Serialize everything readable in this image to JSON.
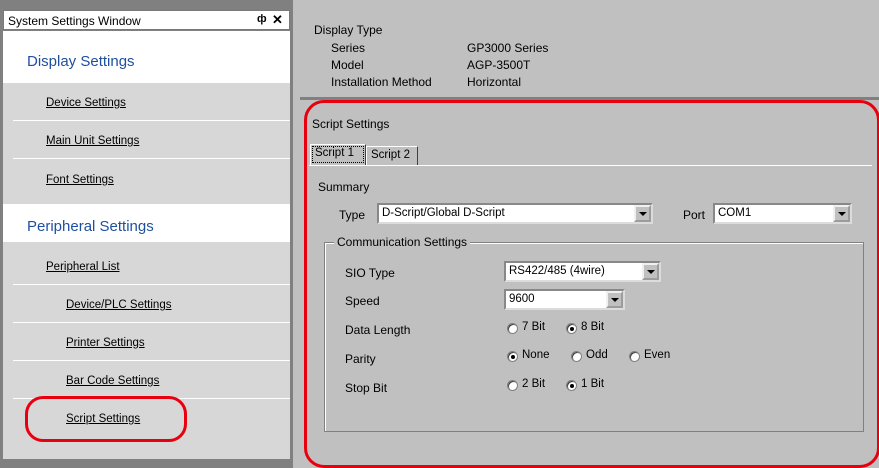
{
  "window": {
    "title": "System Settings Window",
    "pin_glyph": "ф",
    "close_glyph": "✕"
  },
  "sidebar": {
    "display_heading": "Display Settings",
    "display_items": [
      "Device Settings",
      "Main Unit Settings",
      "Font Settings"
    ],
    "peripheral_heading": "Peripheral Settings",
    "peripheral_items": [
      "Peripheral List",
      "Device/PLC Settings",
      "Printer Settings",
      "Bar Code Settings",
      "Script Settings"
    ]
  },
  "display_type": {
    "heading": "Display Type",
    "rows": [
      {
        "label": "Series",
        "value": "GP3000 Series"
      },
      {
        "label": "Model",
        "value": "AGP-3500T"
      },
      {
        "label": "Installation Method",
        "value": "Horizontal"
      }
    ]
  },
  "script_settings": {
    "heading": "Script Settings",
    "tabs": [
      "Script 1",
      "Script 2"
    ],
    "summary_label": "Summary",
    "type_label": "Type",
    "type_value": "D-Script/Global D-Script",
    "port_label": "Port",
    "port_value": "COM1",
    "comm": {
      "title": "Communication Settings",
      "sio_type_label": "SIO Type",
      "sio_type_value": "RS422/485 (4wire)",
      "speed_label": "Speed",
      "speed_value": "9600",
      "data_length_label": "Data Length",
      "data_length_options": [
        "7 Bit",
        "8 Bit"
      ],
      "data_length_selected": "8 Bit",
      "parity_label": "Parity",
      "parity_options": [
        "None",
        "Odd",
        "Even"
      ],
      "parity_selected": "None",
      "stop_bit_label": "Stop Bit",
      "stop_bit_options": [
        "2 Bit",
        "1 Bit"
      ],
      "stop_bit_selected": "1 Bit"
    }
  },
  "colors": {
    "highlight": "#e8000f",
    "heading_blue": "#1f4f9f"
  }
}
